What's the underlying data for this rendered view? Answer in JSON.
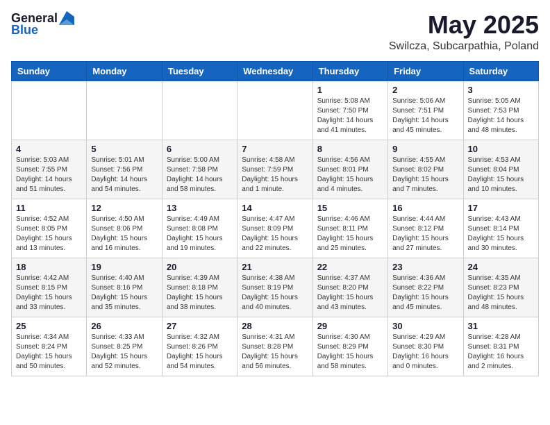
{
  "logo": {
    "general": "General",
    "blue": "Blue"
  },
  "header": {
    "month": "May 2025",
    "location": "Swilcza, Subcarpathia, Poland"
  },
  "weekdays": [
    "Sunday",
    "Monday",
    "Tuesday",
    "Wednesday",
    "Thursday",
    "Friday",
    "Saturday"
  ],
  "weeks": [
    [
      {
        "day": "",
        "info": ""
      },
      {
        "day": "",
        "info": ""
      },
      {
        "day": "",
        "info": ""
      },
      {
        "day": "",
        "info": ""
      },
      {
        "day": "1",
        "info": "Sunrise: 5:08 AM\nSunset: 7:50 PM\nDaylight: 14 hours\nand 41 minutes."
      },
      {
        "day": "2",
        "info": "Sunrise: 5:06 AM\nSunset: 7:51 PM\nDaylight: 14 hours\nand 45 minutes."
      },
      {
        "day": "3",
        "info": "Sunrise: 5:05 AM\nSunset: 7:53 PM\nDaylight: 14 hours\nand 48 minutes."
      }
    ],
    [
      {
        "day": "4",
        "info": "Sunrise: 5:03 AM\nSunset: 7:55 PM\nDaylight: 14 hours\nand 51 minutes."
      },
      {
        "day": "5",
        "info": "Sunrise: 5:01 AM\nSunset: 7:56 PM\nDaylight: 14 hours\nand 54 minutes."
      },
      {
        "day": "6",
        "info": "Sunrise: 5:00 AM\nSunset: 7:58 PM\nDaylight: 14 hours\nand 58 minutes."
      },
      {
        "day": "7",
        "info": "Sunrise: 4:58 AM\nSunset: 7:59 PM\nDaylight: 15 hours\nand 1 minute."
      },
      {
        "day": "8",
        "info": "Sunrise: 4:56 AM\nSunset: 8:01 PM\nDaylight: 15 hours\nand 4 minutes."
      },
      {
        "day": "9",
        "info": "Sunrise: 4:55 AM\nSunset: 8:02 PM\nDaylight: 15 hours\nand 7 minutes."
      },
      {
        "day": "10",
        "info": "Sunrise: 4:53 AM\nSunset: 8:04 PM\nDaylight: 15 hours\nand 10 minutes."
      }
    ],
    [
      {
        "day": "11",
        "info": "Sunrise: 4:52 AM\nSunset: 8:05 PM\nDaylight: 15 hours\nand 13 minutes."
      },
      {
        "day": "12",
        "info": "Sunrise: 4:50 AM\nSunset: 8:06 PM\nDaylight: 15 hours\nand 16 minutes."
      },
      {
        "day": "13",
        "info": "Sunrise: 4:49 AM\nSunset: 8:08 PM\nDaylight: 15 hours\nand 19 minutes."
      },
      {
        "day": "14",
        "info": "Sunrise: 4:47 AM\nSunset: 8:09 PM\nDaylight: 15 hours\nand 22 minutes."
      },
      {
        "day": "15",
        "info": "Sunrise: 4:46 AM\nSunset: 8:11 PM\nDaylight: 15 hours\nand 25 minutes."
      },
      {
        "day": "16",
        "info": "Sunrise: 4:44 AM\nSunset: 8:12 PM\nDaylight: 15 hours\nand 27 minutes."
      },
      {
        "day": "17",
        "info": "Sunrise: 4:43 AM\nSunset: 8:14 PM\nDaylight: 15 hours\nand 30 minutes."
      }
    ],
    [
      {
        "day": "18",
        "info": "Sunrise: 4:42 AM\nSunset: 8:15 PM\nDaylight: 15 hours\nand 33 minutes."
      },
      {
        "day": "19",
        "info": "Sunrise: 4:40 AM\nSunset: 8:16 PM\nDaylight: 15 hours\nand 35 minutes."
      },
      {
        "day": "20",
        "info": "Sunrise: 4:39 AM\nSunset: 8:18 PM\nDaylight: 15 hours\nand 38 minutes."
      },
      {
        "day": "21",
        "info": "Sunrise: 4:38 AM\nSunset: 8:19 PM\nDaylight: 15 hours\nand 40 minutes."
      },
      {
        "day": "22",
        "info": "Sunrise: 4:37 AM\nSunset: 8:20 PM\nDaylight: 15 hours\nand 43 minutes."
      },
      {
        "day": "23",
        "info": "Sunrise: 4:36 AM\nSunset: 8:22 PM\nDaylight: 15 hours\nand 45 minutes."
      },
      {
        "day": "24",
        "info": "Sunrise: 4:35 AM\nSunset: 8:23 PM\nDaylight: 15 hours\nand 48 minutes."
      }
    ],
    [
      {
        "day": "25",
        "info": "Sunrise: 4:34 AM\nSunset: 8:24 PM\nDaylight: 15 hours\nand 50 minutes."
      },
      {
        "day": "26",
        "info": "Sunrise: 4:33 AM\nSunset: 8:25 PM\nDaylight: 15 hours\nand 52 minutes."
      },
      {
        "day": "27",
        "info": "Sunrise: 4:32 AM\nSunset: 8:26 PM\nDaylight: 15 hours\nand 54 minutes."
      },
      {
        "day": "28",
        "info": "Sunrise: 4:31 AM\nSunset: 8:28 PM\nDaylight: 15 hours\nand 56 minutes."
      },
      {
        "day": "29",
        "info": "Sunrise: 4:30 AM\nSunset: 8:29 PM\nDaylight: 15 hours\nand 58 minutes."
      },
      {
        "day": "30",
        "info": "Sunrise: 4:29 AM\nSunset: 8:30 PM\nDaylight: 16 hours\nand 0 minutes."
      },
      {
        "day": "31",
        "info": "Sunrise: 4:28 AM\nSunset: 8:31 PM\nDaylight: 16 hours\nand 2 minutes."
      }
    ]
  ]
}
